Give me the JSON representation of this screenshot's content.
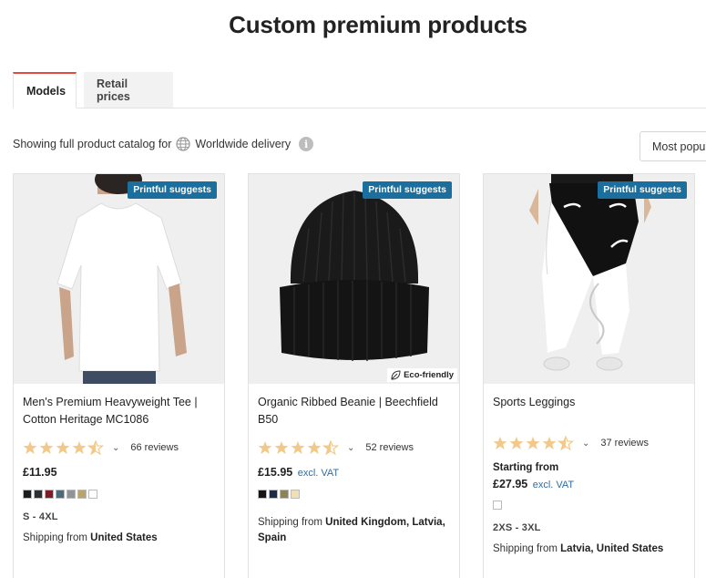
{
  "page": {
    "title": "Custom premium products"
  },
  "tabs": [
    {
      "label": "Models",
      "active": true
    },
    {
      "label": "Retail prices",
      "active": false
    }
  ],
  "catalog": {
    "prefix": "Showing full product catalog for",
    "delivery": "Worldwide delivery",
    "info_icon": "i"
  },
  "sort": {
    "label": "Most popu"
  },
  "products": [
    {
      "badge": "Printful suggests",
      "eco": "",
      "name": "Men's Premium Heavyweight Tee | Cotton Heritage MC1086",
      "rating": 4.5,
      "reviews": "66 reviews",
      "starting": "",
      "price": "£11.95",
      "vat": "",
      "swatches": [
        "#1c1c1c",
        "#2d2f36",
        "#7d1c25",
        "#4c6b7a",
        "#8e9498",
        "#b9a46c",
        "#ffffff"
      ],
      "sizes": "S - 4XL",
      "shipping_prefix": "Shipping from",
      "shipping_from": "United States"
    },
    {
      "badge": "Printful suggests",
      "eco": "Eco-friendly",
      "name": "Organic Ribbed Beanie | Beechfield B50",
      "rating": 4.5,
      "reviews": "52 reviews",
      "starting": "",
      "price": "£15.95",
      "vat": "excl. VAT",
      "swatches": [
        "#141414",
        "#1f2a44",
        "#8c8456",
        "#f1dfb8"
      ],
      "sizes": "",
      "shipping_prefix": "Shipping from",
      "shipping_from": "United Kingdom, Latvia, Spain"
    },
    {
      "badge": "Printful suggests",
      "eco": "",
      "name": "Sports Leggings",
      "rating": 4.5,
      "reviews": "37 reviews",
      "starting": "Starting from",
      "price": "£27.95",
      "vat": "excl. VAT",
      "swatches": [
        "#ffffff"
      ],
      "sizes": "2XS - 3XL",
      "shipping_prefix": "Shipping from",
      "shipping_from": "Latvia, United States"
    }
  ],
  "colors": {
    "badge": "#1a6f9f",
    "star": "#f3c98b",
    "tab_accent": "#e34c3c",
    "vat_link": "#2c6ea6"
  }
}
